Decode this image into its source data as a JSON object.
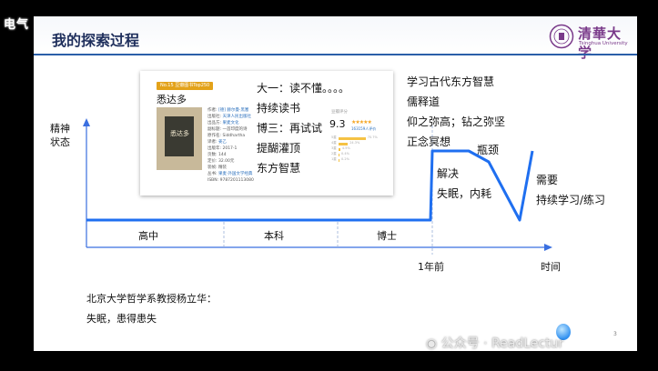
{
  "window": {
    "title": "电气"
  },
  "slide": {
    "title": "我的探索过程",
    "logo": {
      "cn": "清華大学",
      "en": "Tsinghua University"
    },
    "book": {
      "badge": "No.15 豆瓣图书Top250",
      "title": "悉达多",
      "cover_title": "悉达多",
      "meta": [
        {
          "k": "作者:",
          "v": "[德] 赫尔曼·黑塞"
        },
        {
          "k": "出版社:",
          "v": "天津人民出版社"
        },
        {
          "k": "出品方:",
          "v": "果麦文化"
        },
        {
          "k": "副标题:",
          "v": "一首印度的诗"
        },
        {
          "k": "原作名:",
          "v": "Siddhartha"
        },
        {
          "k": "译者:",
          "v": "姜乙"
        },
        {
          "k": "出版年:",
          "v": "2017-1"
        },
        {
          "k": "页数:",
          "v": "144"
        },
        {
          "k": "定价:",
          "v": "32.00元"
        },
        {
          "k": "装帧:",
          "v": "精装"
        },
        {
          "k": "丛书:",
          "v": "果麦·外国文学经典"
        },
        {
          "k": "ISBN:",
          "v": "9787201113080"
        }
      ],
      "rating_label": "豆瓣评分",
      "rating_score": "9.3",
      "rating_stars": "★★★★★",
      "rating_count": "163159人评价",
      "rating_bars": [
        {
          "label": "5星",
          "pct": "70.7%",
          "frac": 0.707
        },
        {
          "label": "4星",
          "pct": "24.3%",
          "frac": 0.243
        },
        {
          "label": "3星",
          "pct": "4.5%",
          "frac": 0.045
        },
        {
          "label": "2星",
          "pct": "0.4%",
          "frac": 0.004
        },
        {
          "label": "1星",
          "pct": "0.2%",
          "frac": 0.002
        }
      ],
      "notes": [
        "大一：读不懂。。。。",
        "持续读书",
        "博三：再试试",
        "提醐灌顶",
        "东方智慧"
      ]
    },
    "right_notes": [
      "学习古代东方智慧",
      "儒释道",
      "仰之弥高；钻之弥坚",
      "正念冥想"
    ],
    "chart": {
      "y_label_1": "精神",
      "y_label_2": "状态",
      "stages": [
        "高中",
        "本科",
        "博士"
      ],
      "time_marks": [
        "1年前",
        "时间"
      ],
      "annotations": [
        "瓶颈",
        "解决",
        "失眠，内耗",
        "需要",
        "持续学习/练习"
      ]
    },
    "bottom": [
      "北京大学哲学系教授杨立华：",
      "失眠，患得患失"
    ],
    "page_number": "3"
  },
  "watermark": "公众号 · ReadLectur",
  "colors": {
    "curve": "#1f6ff0",
    "header_line": "#2b5fa8",
    "title": "#1f2f5c"
  }
}
